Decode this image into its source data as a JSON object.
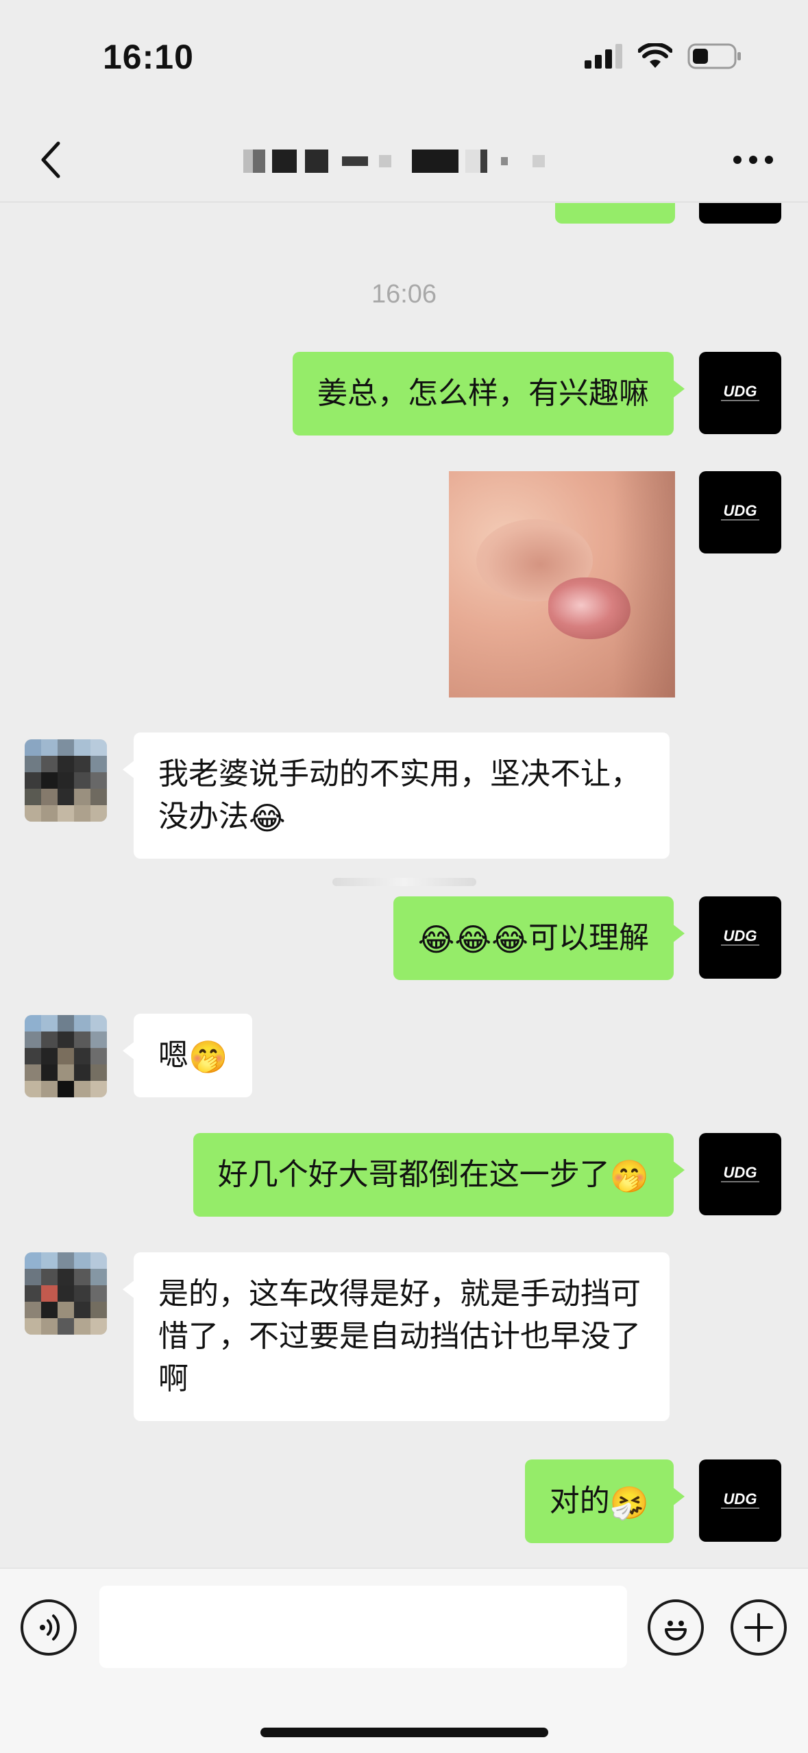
{
  "status_bar": {
    "time": "16:10"
  },
  "nav": {
    "title_hidden": true
  },
  "chat": {
    "timestamp": "16:06",
    "self_avatar_logo": "UDG",
    "messages": [
      {
        "dir": "out",
        "text": "姜总，怎么样，有兴趣嘛"
      },
      {
        "dir": "out",
        "type": "sticker"
      },
      {
        "dir": "in",
        "text": "我老婆说手动的不实用，坚决不让，没办法",
        "emoji": "😂"
      },
      {
        "dir": "out",
        "emoji": "😂😂😂",
        "text": "可以理解"
      },
      {
        "dir": "in",
        "text": "嗯",
        "emoji": "🤭"
      },
      {
        "dir": "out",
        "text": "好几个好大哥都倒在这一步了",
        "emoji": "🤭"
      },
      {
        "dir": "in",
        "text": "是的，这车改得是好，就是手动挡可惜了，不过要是自动挡估计也早没了啊"
      },
      {
        "dir": "out",
        "text": "对的",
        "emoji": "🤧"
      }
    ]
  },
  "input_bar": {
    "placeholder": ""
  },
  "icons": {
    "back": "chevron-left-icon",
    "more": "more-dots-icon",
    "voice": "voice-icon",
    "emoji": "emoji-icon",
    "plus": "plus-icon"
  },
  "colors": {
    "out_bubble": "#95ec69",
    "in_bubble": "#ffffff",
    "background": "#ededed"
  }
}
